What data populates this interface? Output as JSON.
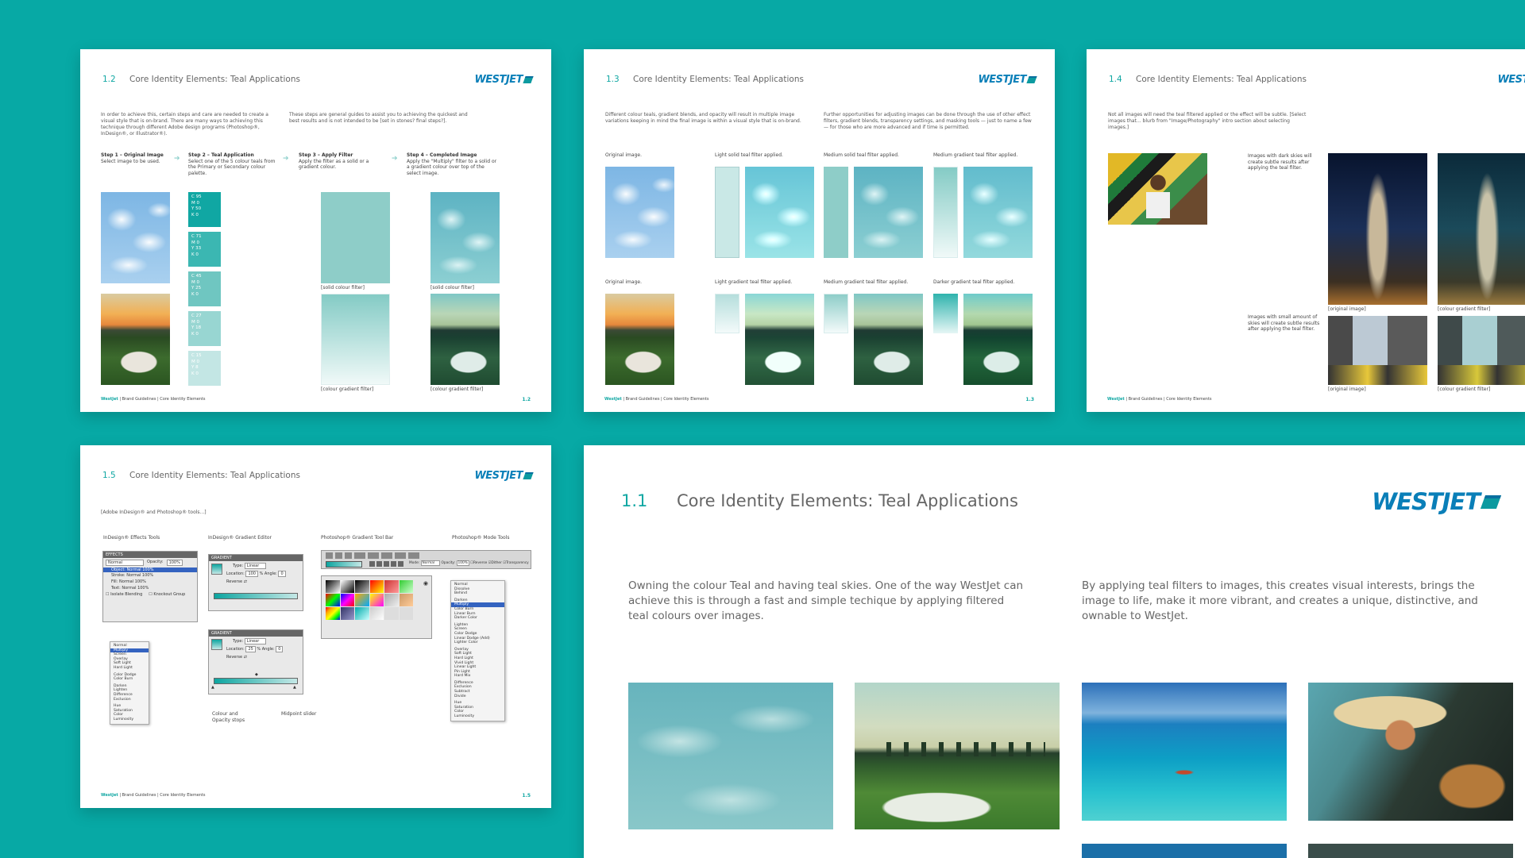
{
  "brand": {
    "logo_text": "WESTJET",
    "accent": "#10a7a3",
    "background": "#07a9a5",
    "logo_color": "#0a7fb8"
  },
  "footer": {
    "company": "WestJet",
    "sep1": "|",
    "guidelines": "Brand Guidelines",
    "sep2": "|",
    "section": "Core Identity Elements"
  },
  "pages": {
    "p12": {
      "number": "1.2",
      "title": "Core Identity Elements: Teal Applications",
      "intro_left": "In order to achieve this, certain steps and care are needed to create a visual style that is on-brand. There are many ways to achieving this technique through different Adobe design programs (Photoshop®, InDesign®, or Illustrator®).",
      "intro_right": "These steps are general guides to assist you to achieving the quickest and best results and is not intended to be [set in stones? final steps?].",
      "steps": [
        {
          "title": "Step 1 – Original Image",
          "desc": "Select image to be used."
        },
        {
          "title": "Step 2 – Teal Application",
          "desc": "Select one of the 5 colour teals from the Primary or Secondary colour palette."
        },
        {
          "title": "Step 3 – Apply Filter",
          "desc": "Apply the filter as a solid or a gradient colour."
        },
        {
          "title": "Step 4 – Completed Image",
          "desc": "Apply the \"Multiply\" filter to a solid or a gradient colour over top of the select image."
        }
      ],
      "swatches": [
        {
          "color": "#10a7a3",
          "c": "C  95",
          "m": "M  0",
          "y": "Y  50",
          "k": "K  0"
        },
        {
          "color": "#3bb7b2",
          "c": "C  71",
          "m": "M  0",
          "y": "Y  33",
          "k": "K  0"
        },
        {
          "color": "#6fc6c1",
          "c": "C  45",
          "m": "M  0",
          "y": "Y  25",
          "k": "K  0"
        },
        {
          "color": "#98d6d2",
          "c": "C  27",
          "m": "M  0",
          "y": "Y  18",
          "k": "K  0"
        },
        {
          "color": "#c3e6e4",
          "c": "C  15",
          "m": "M  0",
          "y": "Y  8",
          "k": "K  0"
        }
      ],
      "captions": {
        "solid": "[solid colour filter]",
        "gradient": "[colour gradient filter]"
      },
      "page_number": "1.2"
    },
    "p13": {
      "number": "1.3",
      "title": "Core Identity Elements: Teal Applications",
      "intro_left": "Different colour teals, gradient blends, and opacity will result in multiple image variations keeping in mind the final image is within a visual style that is on-brand.",
      "intro_right": "Further opportunities for adjusting images can be done through the use of other effect filters, gradient blends, transparency settings, and masking tools — just to name a few — for those who are more advanced and if time is permitted.",
      "row1": [
        "Original image.",
        "Light solid teal filter applied.",
        "Medium solid teal filter applied.",
        "Medium gradient teal filter applied."
      ],
      "row2": [
        "Original image.",
        "Light gradient teal filter applied.",
        "Medium gradient teal filter applied.",
        "Darker gradient teal filter applied."
      ],
      "page_number": "1.3"
    },
    "p14": {
      "number": "1.4",
      "title": "Core Identity Elements: Teal Applications",
      "intro": "Not all images will need the teal filtered applied or the effect will be subtle. [Select images that... blurb from \"Image/Photography\" intro section about selecting images.]",
      "note1": "Images with dark skies will create subtle results after applying the teal filter.",
      "note2": "Images with small amount of skies will create subtle results after applying the teal filter.",
      "cap_original": "[original image]",
      "cap_filter": "[colour gradient filter]"
    },
    "p15": {
      "number": "1.5",
      "title": "Core Identity Elements: Teal Applications",
      "intro": "[Adobe InDesign® and Photoshop® tools...]",
      "tools": [
        "InDesign® Effects Tools",
        "InDesign® Gradient Editor",
        "Photoshop® Gradient Tool Bar",
        "Photoshop® Mode Tools"
      ],
      "effects_panel": {
        "title": "EFFECTS",
        "mode": "Normal",
        "opacity_label": "Opacity:",
        "opacity": "100%",
        "rows": [
          "Object: Normal 100%",
          "Stroke: Normal 100%",
          "Fill: Normal 100%",
          "Text: Normal 100%"
        ],
        "iso": "Isolate Blending",
        "knock": "Knockout Group"
      },
      "gradient_panel": {
        "title": "GRADIENT",
        "type_label": "Type:",
        "type": "Linear",
        "location_label": "Location:",
        "location1": "100",
        "location2": "25",
        "angle_label": "Angle:",
        "angle": "0",
        "reverse": "Reverse"
      },
      "blend_menu_small": [
        "Normal",
        "Multiply",
        "Screen",
        "Overlay",
        "Soft Light",
        "Hard Light",
        "Color Dodge",
        "Color Burn",
        "Darken",
        "Lighten",
        "Difference",
        "Exclusion",
        "Hue",
        "Saturation",
        "Color",
        "Luminosity"
      ],
      "blend_menu_large": [
        "Normal",
        "Dissolve",
        "Behind",
        "Darken",
        "Multiply",
        "Color Burn",
        "Linear Burn",
        "Darker Color",
        "Lighten",
        "Screen",
        "Color Dodge",
        "Linear Dodge (Add)",
        "Lighter Color",
        "Overlay",
        "Soft Light",
        "Hard Light",
        "Vivid Light",
        "Linear Light",
        "Pin Light",
        "Hard Mix",
        "Difference",
        "Exclusion",
        "Subtract",
        "Divide",
        "Hue",
        "Saturation",
        "Color",
        "Luminosity"
      ],
      "ps_bar": {
        "mode_label": "Mode:",
        "mode": "Normal",
        "opacity_label": "Opacity:",
        "opacity": "100%",
        "reverse": "Reverse",
        "dither": "Dither",
        "transparency": "Transparency"
      },
      "callouts": {
        "stops": "Colour and Opacity stops",
        "midpoint": "Midpoint slider"
      },
      "page_number": "1.5"
    },
    "p11": {
      "number": "1.1",
      "title": "Core Identity Elements: Teal Applications",
      "body_left": "Owning the colour Teal and having teal skies. One of the way WestJet can achieve this is through a fast and simple techique by applying filtered teal colours over images.",
      "body_right": "By applying teal filters to images, this creates visual interests, brings the image to life, make it more vibrant, and creates a unique, distinctive, and ownable to WestJet."
    }
  }
}
